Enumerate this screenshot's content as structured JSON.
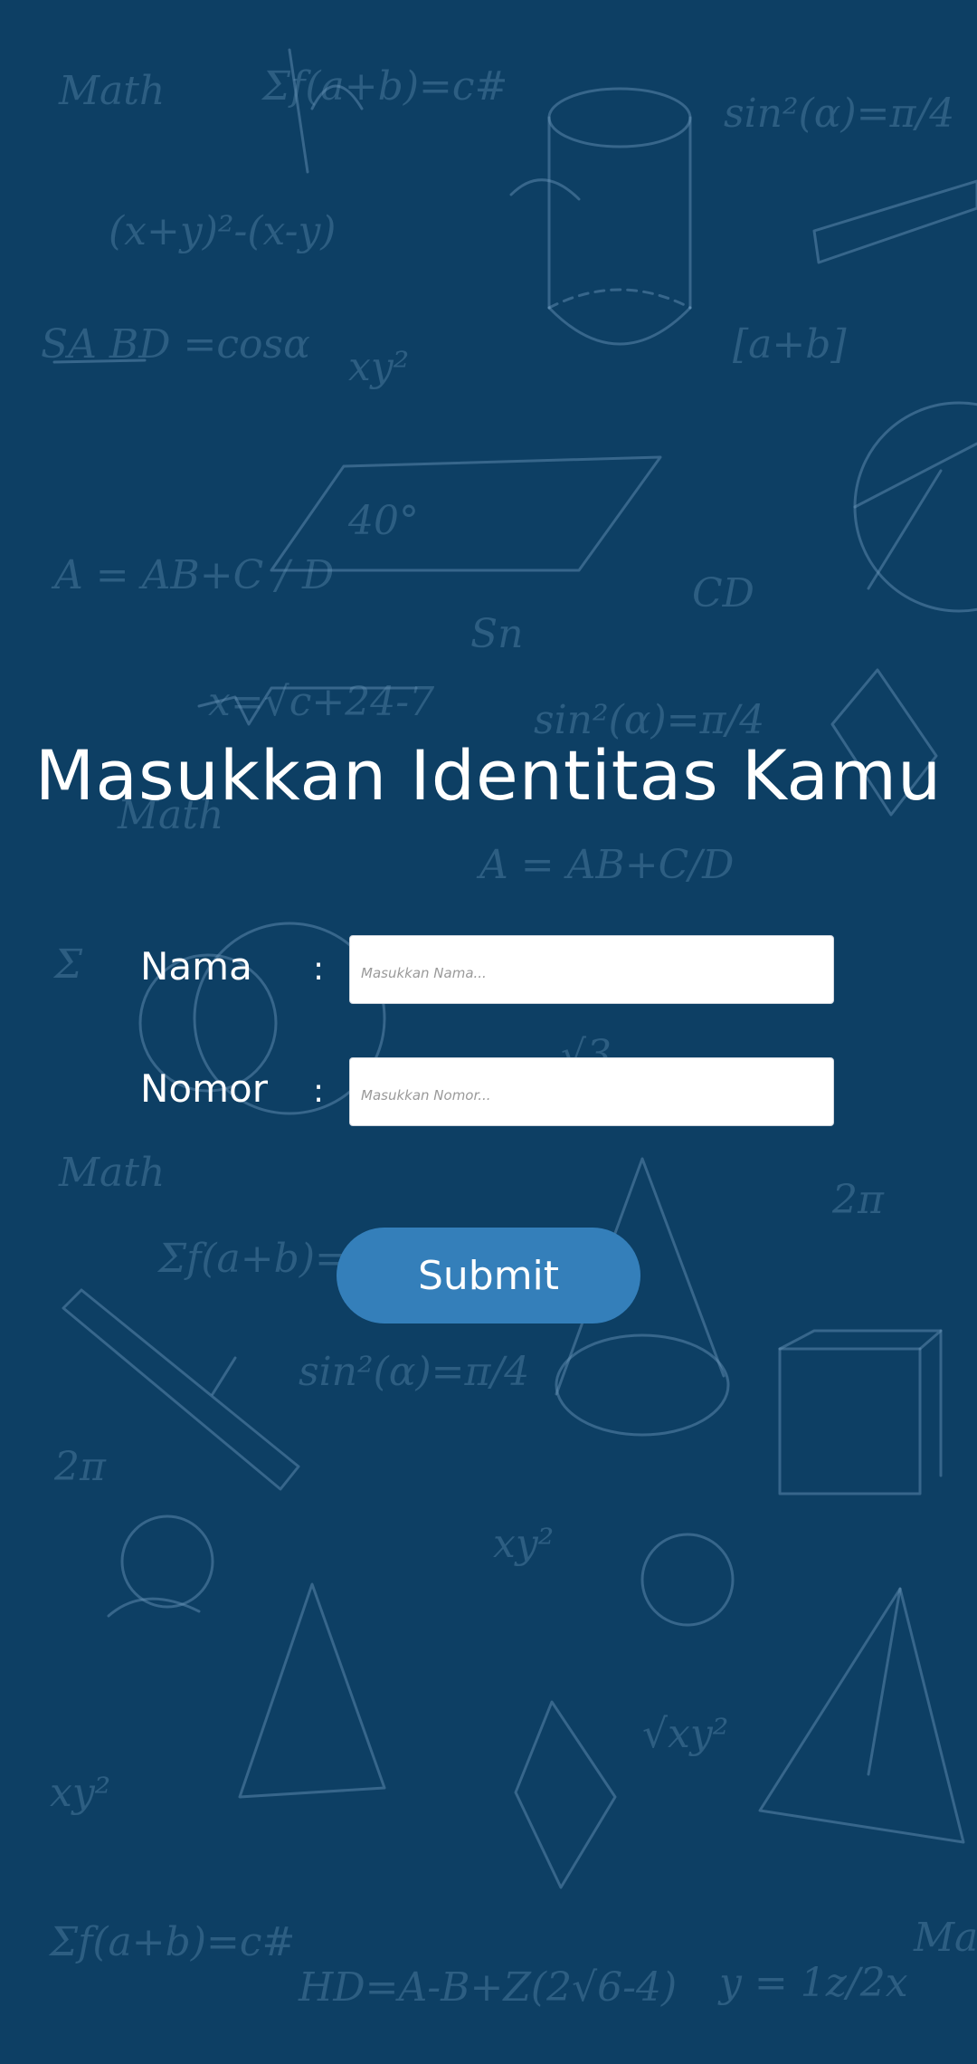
{
  "form": {
    "title": "Masukkan Identitas Kamu",
    "name_label": "Nama",
    "name_colon": ":",
    "name_placeholder": "Masukkan Nama...",
    "name_value": "",
    "number_label": "Nomor",
    "number_colon": ":",
    "number_placeholder": "Masukkan Nomor...",
    "number_value": "",
    "submit_label": "Submit"
  },
  "colors": {
    "background": "#0d3f64",
    "submit_button": "#347fba",
    "doodles": "#6b97bb"
  }
}
